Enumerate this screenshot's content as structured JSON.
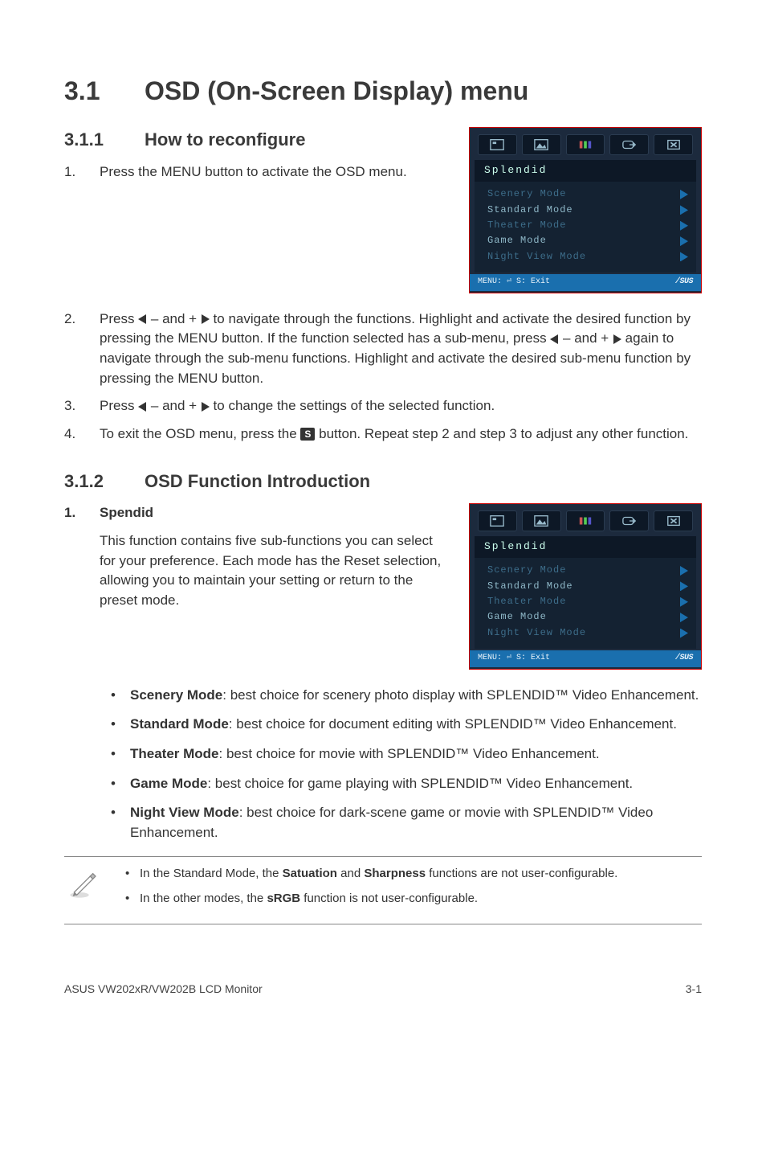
{
  "h1": {
    "num": "3.1",
    "title": "OSD (On-Screen Display) menu"
  },
  "s311": {
    "num": "3.1.1",
    "title": "How to reconfigure"
  },
  "step1": {
    "marker": "1.",
    "text": "Press the MENU button to activate the OSD menu."
  },
  "step2": {
    "marker": "2.",
    "p1": "Press ",
    "p2": " – and + ",
    "p3": " to navigate through the functions. Highlight and activate the desired function by pressing the MENU button. If the function selected has a sub-menu, press ",
    "p4": " – and + ",
    "p5": " again to navigate through the sub-menu functions. Highlight and activate the desired sub-menu function by pressing the MENU button."
  },
  "step3": {
    "marker": "3.",
    "p1": "Press ",
    "p2": " – and + ",
    "p3": " to change the settings of the selected function."
  },
  "step4": {
    "marker": "4.",
    "p1": "To exit the OSD menu, press the ",
    "sbtn": "S",
    "p2": " button. Repeat step 2 and step 3 to adjust any other function."
  },
  "s312": {
    "num": "3.1.2",
    "title": "OSD Function Introduction"
  },
  "splendid": {
    "marker": "1.",
    "heading": "Spendid",
    "para": "This function contains five sub-functions you can select for your preference. Each mode has the Reset selection, allowing you to maintain your setting or return to the preset mode."
  },
  "modes": {
    "scenery": {
      "name": "Scenery Mode",
      "desc": ": best choice for scenery photo display with SPLENDID™ Video Enhancement."
    },
    "standard": {
      "name": "Standard Mode",
      "desc": ": best choice for document editing with SPLENDID™ Video Enhancement."
    },
    "theater": {
      "name": "Theater Mode",
      "desc": ": best choice for movie with SPLENDID™ Video Enhancement."
    },
    "game": {
      "name": "Game Mode",
      "desc": ": best choice for game playing with SPLENDID™ Video Enhancement."
    },
    "night": {
      "name": "Night View Mode",
      "desc": ": best choice for dark-scene game or movie with SPLENDID™ Video Enhancement."
    }
  },
  "notes": {
    "n1a": "In the Standard Mode, the ",
    "n1b": "Satuation",
    "n1c": " and ",
    "n1d": "Sharpness",
    "n1e": " functions are not user-configurable.",
    "n2a": "In the other modes, the ",
    "n2b": "sRGB",
    "n2c": " function is not user-configurable."
  },
  "footer": {
    "left": "ASUS VW202xR/VW202B LCD Monitor",
    "right": "3-1"
  },
  "osd": {
    "title": "Splendid",
    "items": [
      {
        "label": "Scenery Mode",
        "alt": false
      },
      {
        "label": "Standard Mode",
        "alt": true
      },
      {
        "label": "Theater Mode",
        "alt": false
      },
      {
        "label": "Game Mode",
        "alt": true
      },
      {
        "label": "Night View Mode",
        "alt": false
      }
    ],
    "foot_left": "MENU: ⏎   S: Exit",
    "foot_right": "/SUS"
  }
}
